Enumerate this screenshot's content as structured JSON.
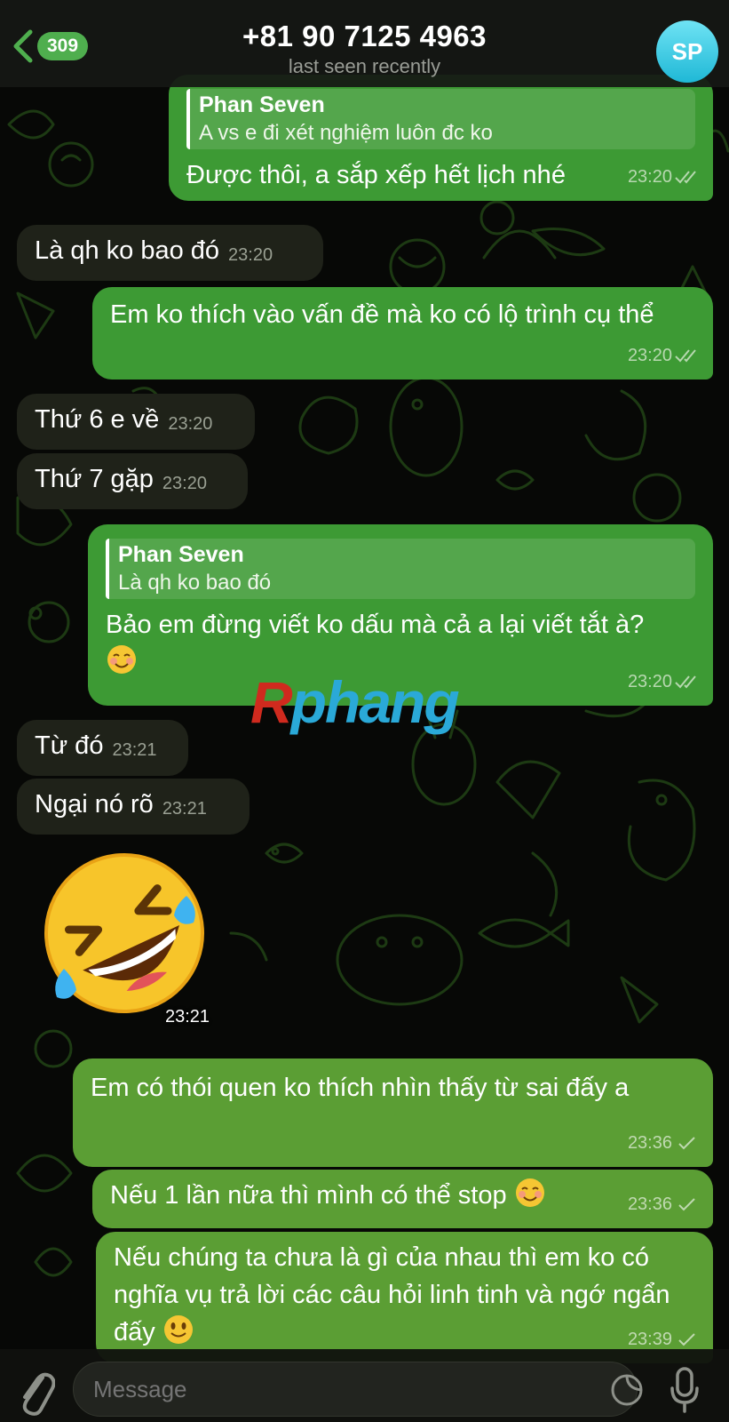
{
  "header": {
    "back_count": "309",
    "title": "+81 90 7125 4963",
    "subtitle": "last seen recently",
    "avatar_initials": "SP"
  },
  "messages": [
    {
      "dir": "out",
      "reply_name": "Phan Seven",
      "reply_text": "A vs e đi xét nghiệm luôn đc ko",
      "text": "Được thôi, a sắp xếp hết lịch nhé",
      "time": "23:20",
      "status": "read"
    },
    {
      "dir": "in",
      "text": "Là qh ko bao đó",
      "time": "23:20"
    },
    {
      "dir": "out",
      "text": "Em ko thích vào vấn đề mà ko có lộ trình cụ thể",
      "time": "23:20",
      "status": "read"
    },
    {
      "dir": "in",
      "text": "Thứ 6 e về",
      "time": "23:20"
    },
    {
      "dir": "in",
      "text": "Thứ 7 gặp",
      "time": "23:20"
    },
    {
      "dir": "out",
      "reply_name": "Phan Seven",
      "reply_text": "Là qh ko bao đó",
      "text": "Bảo em đừng viết ko dấu mà cả a lại viết tắt à?",
      "time": "23:20",
      "status": "read"
    },
    {
      "dir": "in",
      "text": "Từ đó",
      "time": "23:21"
    },
    {
      "dir": "in",
      "text": "Ngại nó rõ",
      "time": "23:21"
    },
    {
      "dir": "in",
      "type": "sticker",
      "sticker": "rolling-on-floor-laughing",
      "time": "23:21"
    },
    {
      "dir": "out",
      "text": "Em có thói quen ko thích nhìn thấy từ sai đấy a",
      "time": "23:36",
      "status": "sent"
    },
    {
      "dir": "out",
      "text": "Nếu 1 lần nữa thì mình có thể stop",
      "time": "23:36",
      "status": "sent"
    },
    {
      "dir": "out",
      "text": "Nếu chúng ta chưa là gì của nhau thì em ko có nghĩa vụ trả lời các câu hỏi linh tinh và ngớ ngẩn đấy",
      "time": "23:39",
      "status": "sent"
    }
  ],
  "watermark": {
    "first": "R",
    "rest": "phang"
  },
  "composer": {
    "placeholder": "Message"
  },
  "colors": {
    "accent": "#4fae4e",
    "outgoing": "#3d9a34",
    "incoming": "#1f2219",
    "doodle": "#1d3a13"
  },
  "icons": [
    "chevron-left-icon",
    "paperclip-icon",
    "sticker-icon",
    "microphone-icon",
    "double-check-icon",
    "check-icon"
  ]
}
